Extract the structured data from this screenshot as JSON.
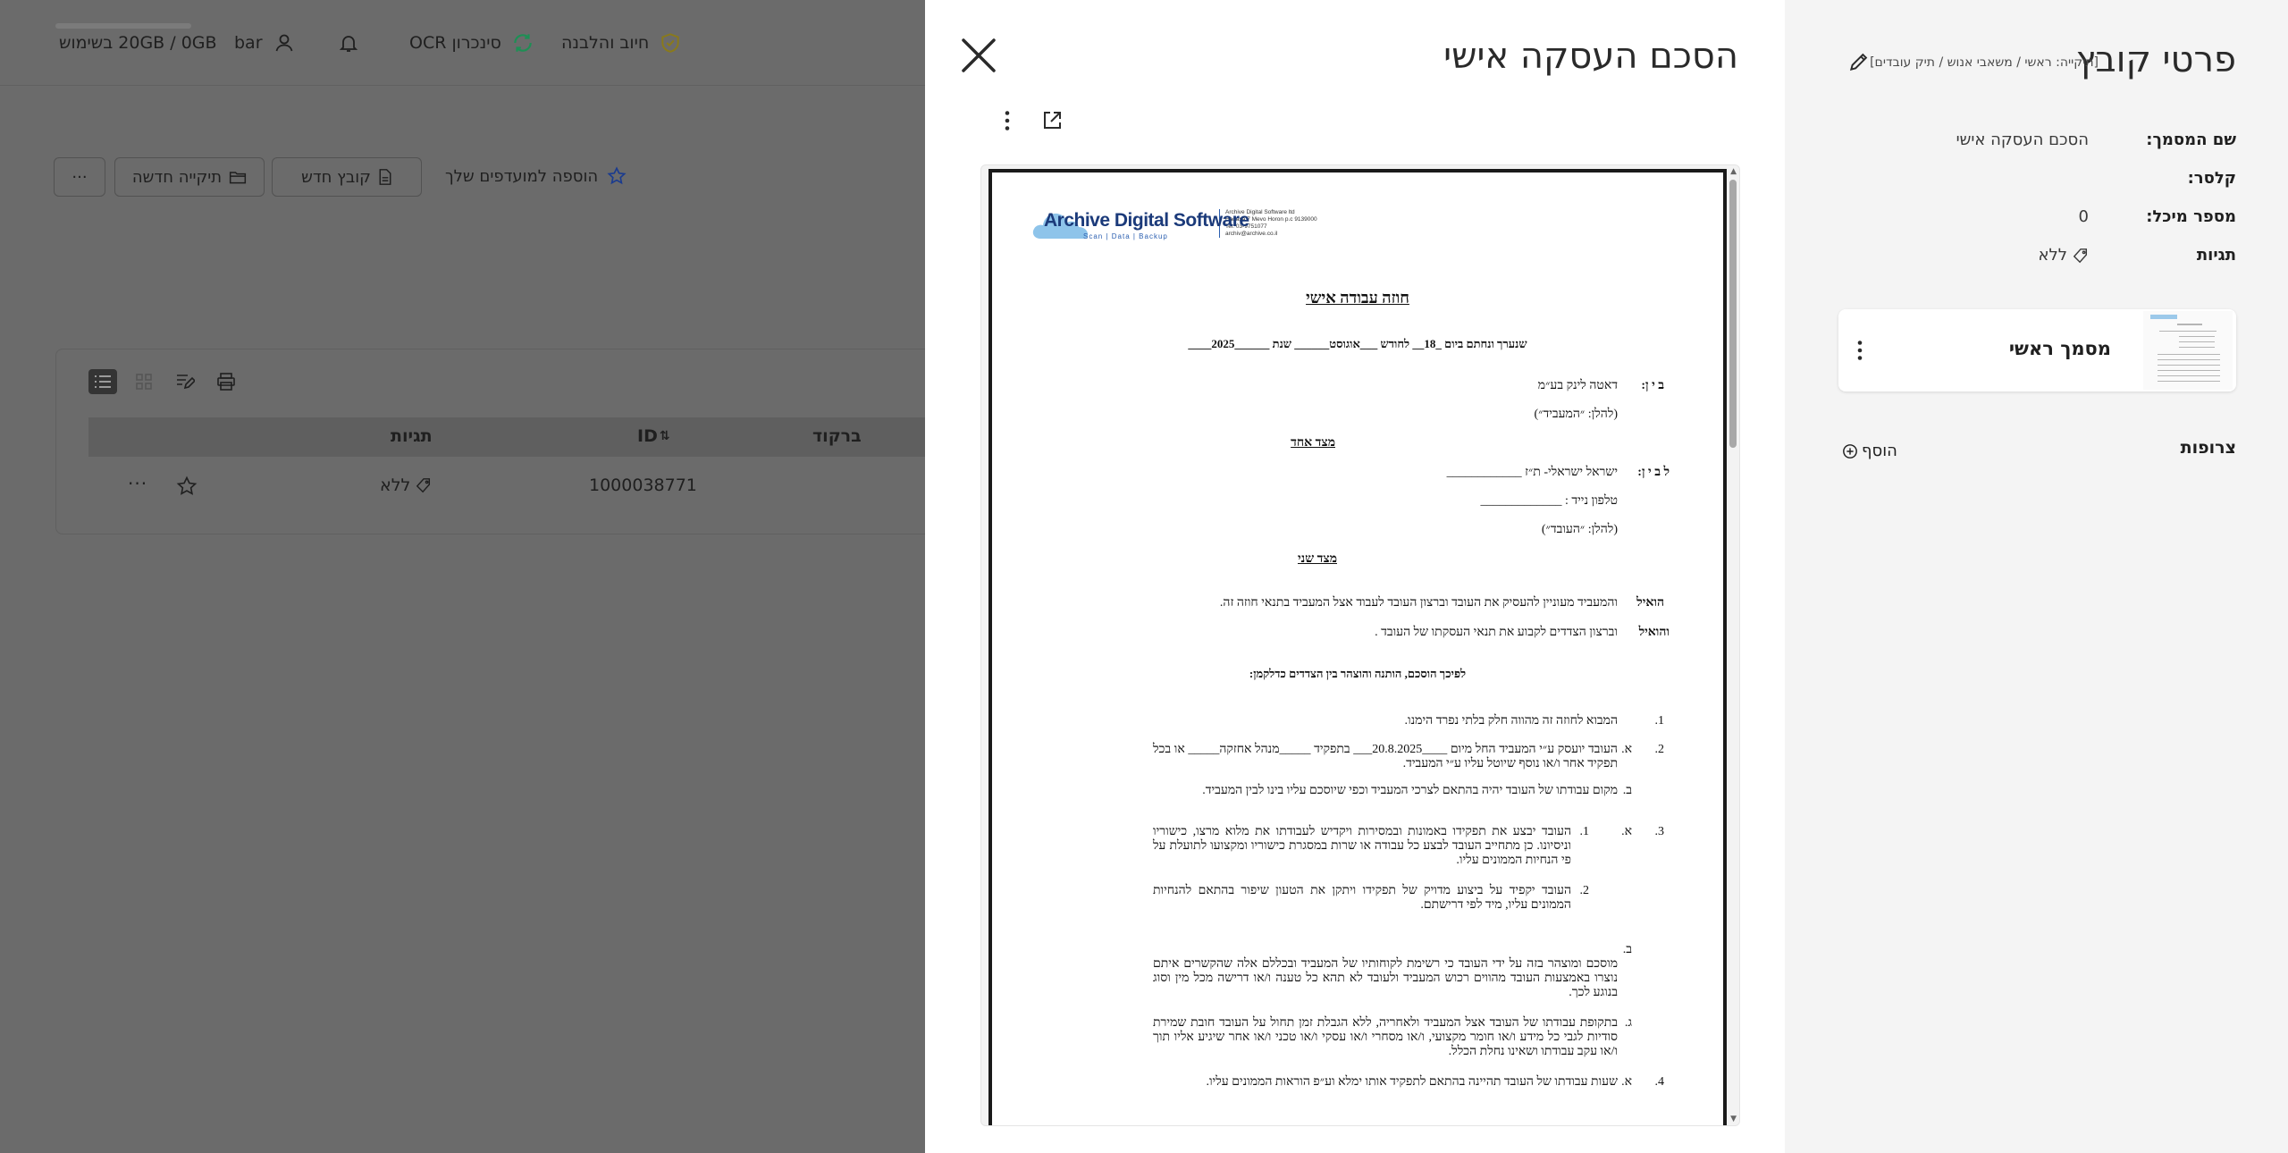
{
  "topbar": {
    "storage": "20GB / 0GB בשימוש",
    "user": "bar",
    "ocr_sync": "סינכרון OCR",
    "billing": "חיוב והלבנה"
  },
  "actions": {
    "more": "···",
    "new_folder": "תיקייה חדשה",
    "new_file": "קובץ חדש",
    "add_favorite": "הוספה למועדפים שלך"
  },
  "table": {
    "headers": {
      "tags": "תגיות",
      "id": "ID",
      "barcode": "ברקוד"
    },
    "row": {
      "tags": "ללא",
      "id": "1000038771"
    }
  },
  "viewer": {
    "title": "הסכם העסקה אישי"
  },
  "document": {
    "logo": {
      "name": "Archive Digital Software",
      "tagline": "Scan | Data | Backup",
      "info": [
        "Archive Digital Software ltd",
        "Hadasa 7 Mevo Horon p.c 9139000",
        "Tel: 03-9751077",
        "archiv@archive.co.il"
      ]
    },
    "title": "חוזה עבודה אישי",
    "date_line": "שנערך ונחתם ביום _18__ לחודש ___אוגוסט______ שנת ______2025____",
    "between_label": "ב י ן:",
    "employer_name": "דאטה לינק בע״מ",
    "employer_alias": "(להלן: ״המעביד״)",
    "side_one": "מצד אחד",
    "and_between_label": "ל ב י ן:",
    "employee_name": "ישראל ישראלי- ת״ז ____________",
    "employee_phone": "טלפון נייד : _____________",
    "employee_alias": "(להלן: ״העובד״)",
    "side_two": "מצד שני",
    "whereas_label": "הואיל",
    "whereas_text": "והמעביד מעוניין להעסיק את העובד וברצון העובד לעבוד אצל המעביד בתנאי חוזה זה.",
    "and_whereas_label": "והואיל",
    "and_whereas_text": "וברצון הצדדים לקבוע את תנאי העסקתו של העובד .",
    "therefore": "לפיכך הוסכם, הותנה והוצהר בין הצדדים כדלקמן:",
    "n1": "1.",
    "c1": "המבוא לחוזה זה מהווה חלק בלתי נפרד הימנו.",
    "n2": "2.",
    "la": "א.",
    "c2a": "העובד יועסק ע״י המעביד החל מיום ____20.8.2025___ בתפקיד _____מנהל אחזקה_____ או בכל תפקיד אחר ו/או נוסף שיוטל עליו ע״י המעביד.",
    "lb": "ב.",
    "c2b": "מקום עבודתו של העובד יהיה בהתאם לצרכי המעביד וכפי שיוסכם עליו בינו לבין המעביד.",
    "n3": "3.",
    "la3": "א.",
    "s1": "1.",
    "c3a1": "העובד יבצע את תפקידו באמונות ובמסירות ויקדיש לעבודתו את מלוא מרצו, כישוריו וניסיונו. כן מתחייב העובד לבצע כל עבודה או שרות במסגרת כישוריו ומקצועו לתועלת על פי הנחיות הממונים עליו.",
    "s2": "2.",
    "c3a2": "העובד יקפיד על ביצוע מדויק של תפקידו ויתקן את הטעון שיפור בהתאם להנחיות הממונים עליו, מיד לפי דרישתם.",
    "lb3": "ב.",
    "c3b": "מוסכם ומוצהר בזה על ידי העובד כי רשימת לקוחותיו של המעביד ובכללם אלה שהקשרים איתם נוצרו באמצעות העובד מהווים רכוש המעביד ולעובד לא תהא כל טענה ו/או דרישה מכל מין וסוג בנוגע לכך.",
    "lc3": "ג.",
    "c3c": "בתקופת עבודתו של העובד אצל המעביד ולאחריה, ללא הגבלת זמן תחול על העובד חובת שמירת סודיות לגבי כל מידע ו/או חומר מקצועי, ו/או מסחרי ו/או עסקי ו/או טכני ו/או אחר שיגיע אליו תוך ו/או עקב עבודתו ושאינו נחלת הכלל.",
    "n4": "4.",
    "la4": "א.",
    "c4a": "שעות עבודתו של העובד תהיינה בהתאם לתפקיד אותו ימלא וע״פ הוראות הממונים עליו."
  },
  "details": {
    "title": "פרטי קובץ",
    "breadcrumb": "[תיקייה: ראשי / משאבי אנוש / תיק עובדים]",
    "doc_name_label": "שם המסמך:",
    "doc_name_value": "הסכם העסקה אישי",
    "folder_label": "קלסר:",
    "folder_value": "",
    "container_label": "מספר מיכל:",
    "container_value": "0",
    "tags_label": "תגיות",
    "tags_value": "ללא",
    "main_doc_label": "מסמך ראשי",
    "attachments_label": "צרופות",
    "add_label": "הוסף"
  }
}
